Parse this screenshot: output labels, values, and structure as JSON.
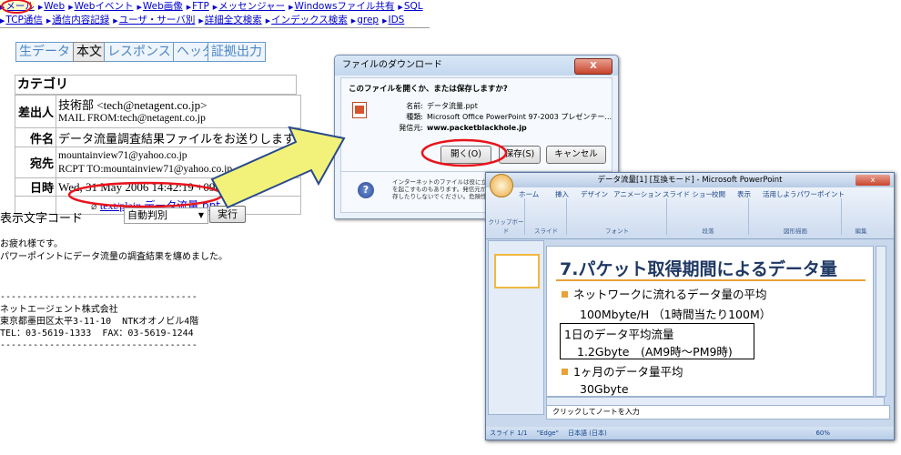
{
  "nav": {
    "row1": [
      "メール",
      "Web",
      "Webイベント",
      "Web画像",
      "FTP",
      "メッセンジャー",
      "Windowsファイル共有",
      "SQL"
    ],
    "row2": [
      "TCP通信",
      "通信内容記録",
      "ユーザ・サーバ別",
      "詳細全文検索",
      "インデックス検索",
      "grep",
      "IDS"
    ]
  },
  "view_tabs": [
    "生データ",
    "本文",
    "レスポンス",
    "ヘッダ",
    "証拠出力"
  ],
  "category_label": "カテゴリ",
  "mail": {
    "from_label": "差出人",
    "from_value": "技術部 <tech@netagent.co.jp>",
    "from_sub": "MAIL FROM:tech@netagent.co.jp",
    "subject_label": "件名",
    "subject_value": "データ流量調査結果ファイルをお送りします",
    "to_label": "宛先",
    "to_value": "mountainview71@yahoo.co.jp",
    "to_sub": "RCPT TO:mountainview71@yahoo.co.jp",
    "date_label": "日時",
    "date_value": "Wed, 31 May 2006 14:42:19 +0900",
    "attachment_type": "text/plain",
    "attachment_name": "データ流量.ppt"
  },
  "charset": {
    "label": "表示文字コード",
    "selected": "自動判別",
    "run_button": "実行"
  },
  "body_text": {
    "line1": "お疲れ様です。",
    "line2": "パワーポイントにデータ流量の調査結果を纏めました。",
    "rule": "------------------------------------",
    "company": "ネットエージェント株式会社",
    "address": "東京都墨田区太平3-11-10  NTKオオノビル4階",
    "tel": "TEL：03-5619-1333  FAX：03-5619-1244"
  },
  "download_dialog": {
    "title": "ファイルのダウンロード",
    "question": "このファイルを開くか、または保存しますか?",
    "name_label": "名前:",
    "name_value": "データ流量.ppt",
    "type_label": "種類:",
    "type_value": "Microsoft Office PowerPoint 97-2003 プレゼンテー...",
    "from_label": "発信元:",
    "from_value": "www.packetblackhole.jp",
    "open_button": "開く(O)",
    "save_button": "保存(S)",
    "cancel_button": "キャンセル",
    "warning_line1": "インターネットのファイルは役に立ち",
    "warning_line2": "を起こすものもあります。発信元が",
    "warning_line3": "存したりしないでください。危険性の",
    "close": "X"
  },
  "powerpoint": {
    "title": "データ流量[1] [互換モード] - Microsoft PowerPoint",
    "tabs": [
      "ホーム",
      "挿入",
      "デザイン",
      "アニメーション",
      "スライド ショー",
      "校閲",
      "表示",
      "活用しようパワーポイント"
    ],
    "groups": [
      "クリップボード",
      "スライド",
      "フォント",
      "段落",
      "図形描画",
      "編集"
    ],
    "slide_title": "7.パケット取得期間によるデータ量",
    "bullet1": "ネットワークに流れるデータ量の平均",
    "bullet1_sub": "100Mbyte/H （1時間当たり100M）",
    "box_line1": "1日のデータ平均流量",
    "box_line2": "1.2Gbyte　(AM9時～PM9時)",
    "bullet2": "1ヶ月のデータ量平均",
    "bullet2_sub": "30Gbyte",
    "notes_placeholder": "クリックしてノートを入力",
    "status_slide": "スライド 1/1",
    "status_theme": "\"Edge\"",
    "status_lang": "日本語 (日本)",
    "zoom": "60%"
  },
  "colors": {
    "link": "#0000cc",
    "highlight_oval": "#e8141c",
    "arrow_fill": "#f2f27a",
    "arrow_stroke": "#2a4a8c",
    "accent_orange": "#e8a23a",
    "slide_title": "#1f3864"
  }
}
